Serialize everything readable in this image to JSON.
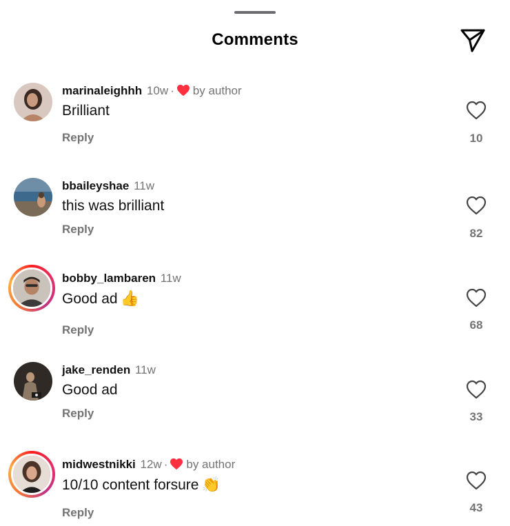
{
  "header": {
    "title": "Comments",
    "share_icon": "paper-plane-icon"
  },
  "comments": [
    {
      "username": "marinaleighhh",
      "time": "10w",
      "author_liked": true,
      "author_label": "by author",
      "text": "Brilliant",
      "emoji": "",
      "reply_label": "Reply",
      "likes": "10"
    },
    {
      "username": "bbaileyshae",
      "time": "11w",
      "author_liked": false,
      "author_label": "",
      "text": "this was brilliant",
      "emoji": "",
      "reply_label": "Reply",
      "likes": "82"
    },
    {
      "username": "bobby_lambaren",
      "time": "11w",
      "author_liked": false,
      "author_label": "",
      "text": "Good ad",
      "emoji": "👍",
      "reply_label": "Reply",
      "likes": "68"
    },
    {
      "username": "jake_renden",
      "time": "11w",
      "author_liked": false,
      "author_label": "",
      "text": "Good ad",
      "emoji": "",
      "reply_label": "Reply",
      "likes": "33"
    },
    {
      "username": "midwestnikki",
      "time": "12w",
      "author_liked": true,
      "author_label": "by author",
      "text": "10/10 content forsure",
      "emoji": "👏",
      "reply_label": "Reply",
      "likes": "43"
    }
  ],
  "colors": {
    "heart_red": "#ff3040",
    "secondary_text": "#737373",
    "story_ring": "#e1306c"
  }
}
